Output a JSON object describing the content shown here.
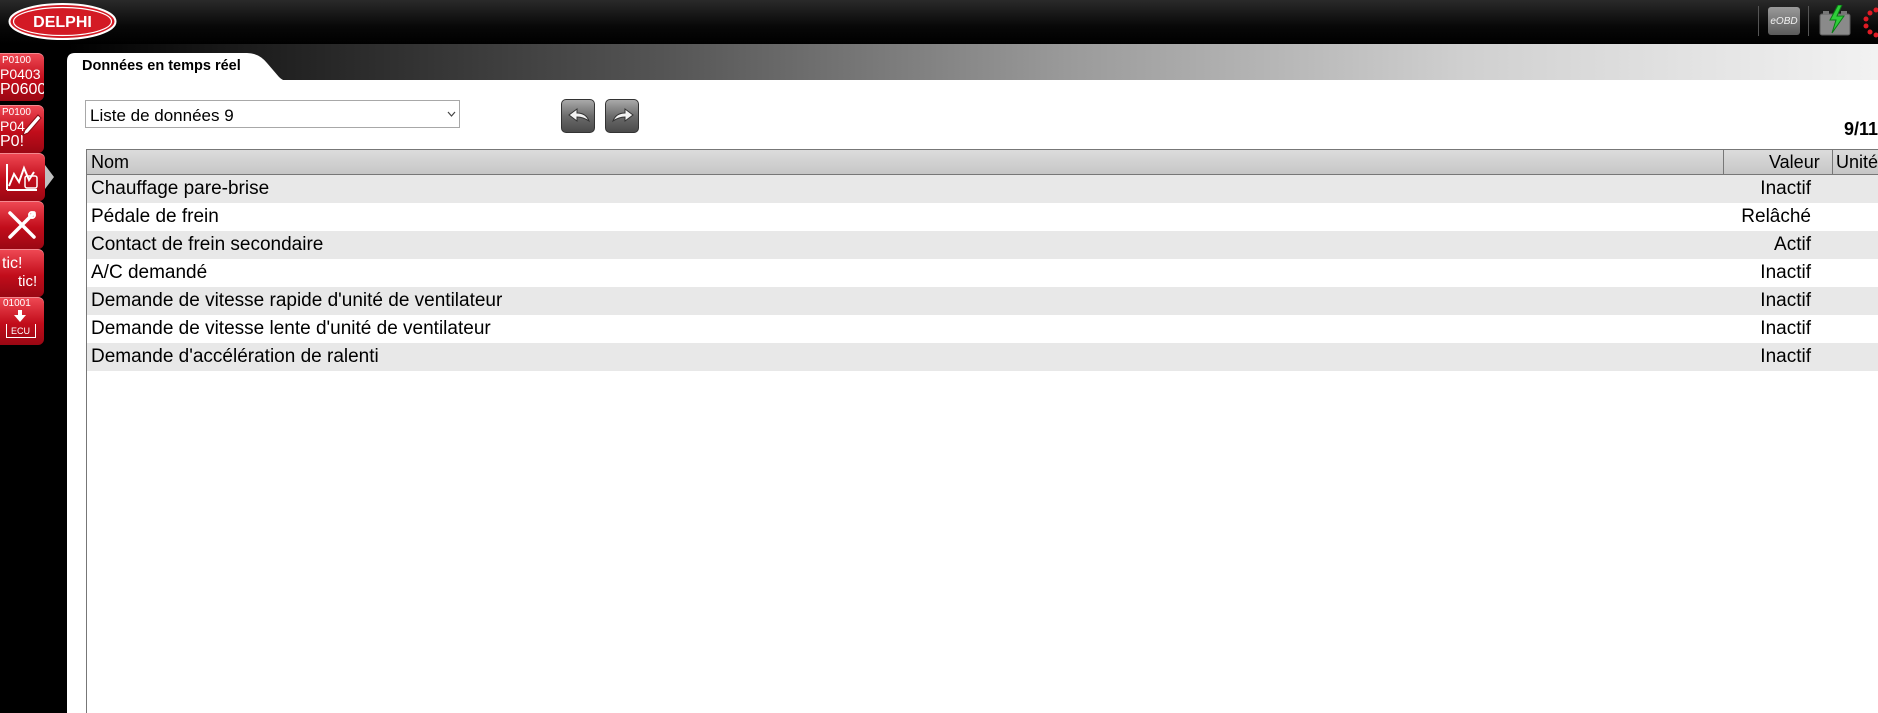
{
  "app": {
    "brand": "DELPHI",
    "eobd_label": "eOBD"
  },
  "dock": [
    {
      "id": "dtc",
      "lines": [
        "P0100",
        "P0403",
        "P0600"
      ]
    },
    {
      "id": "dtc-clear",
      "lines": [
        "P0100",
        "P04",
        "P0!"
      ]
    },
    {
      "id": "live-data",
      "lines": []
    },
    {
      "id": "tools",
      "lines": []
    },
    {
      "id": "tic",
      "lines": [
        "tic!",
        "tic!"
      ]
    },
    {
      "id": "ecu-program",
      "lines": [
        "01001",
        "ECU"
      ]
    }
  ],
  "tab": {
    "label": "Données en temps réel"
  },
  "data_list": {
    "selected": "Liste de données 9"
  },
  "pager": "9/11",
  "table": {
    "headers": {
      "name": "Nom",
      "value": "Valeur",
      "unit": "Unité"
    },
    "rows": [
      {
        "name": "Chauffage pare-brise",
        "value": "Inactif",
        "unit": ""
      },
      {
        "name": "Pédale de frein",
        "value": "Relâché",
        "unit": ""
      },
      {
        "name": "Contact de frein secondaire",
        "value": "Actif",
        "unit": ""
      },
      {
        "name": "A/C demandé",
        "value": "Inactif",
        "unit": ""
      },
      {
        "name": "Demande de vitesse rapide d'unité de ventilateur",
        "value": "Inactif",
        "unit": ""
      },
      {
        "name": "Demande de vitesse lente d'unité de ventilateur",
        "value": "Inactif",
        "unit": ""
      },
      {
        "name": "Demande d'accélération de ralenti",
        "value": "Inactif",
        "unit": ""
      }
    ]
  },
  "colors": {
    "brand_red": "#d31a24",
    "row_alt": "#e8e8e8",
    "header_bg": "#cfcfcf"
  }
}
